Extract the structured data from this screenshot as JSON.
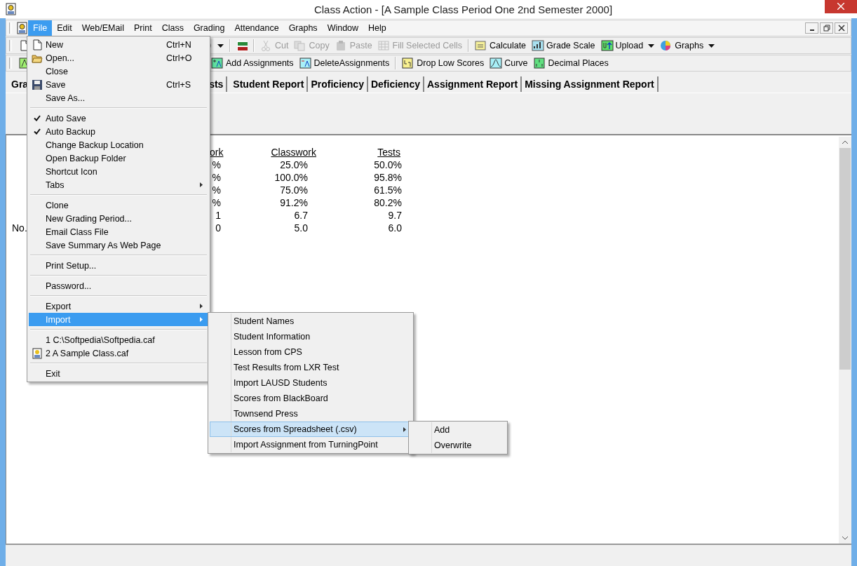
{
  "window": {
    "title": "Class Action - [A Sample Class Period One 2nd Semester 2000]"
  },
  "menubar": [
    {
      "label": "File",
      "selected": true
    },
    {
      "label": "Edit",
      "selected": false
    },
    {
      "label": "Web/EMail",
      "selected": false
    },
    {
      "label": "Print",
      "selected": false
    },
    {
      "label": "Class",
      "selected": false
    },
    {
      "label": "Grading",
      "selected": false
    },
    {
      "label": "Attendance",
      "selected": false
    },
    {
      "label": "Graphs",
      "selected": false
    },
    {
      "label": "Window",
      "selected": false
    },
    {
      "label": "Help",
      "selected": false
    }
  ],
  "toolbar_1": [
    {
      "kind": "icon"
    },
    {
      "kind": "gap"
    },
    {
      "kind": "dropdown-icon"
    },
    {
      "kind": "sep"
    },
    {
      "kind": "icon"
    },
    {
      "kind": "sep"
    },
    {
      "kind": "button",
      "label": "Cut",
      "disabled": true
    },
    {
      "kind": "button",
      "label": "Copy",
      "disabled": true
    },
    {
      "kind": "button",
      "label": "Paste",
      "disabled": true
    },
    {
      "kind": "button",
      "label": "Fill Selected Cells",
      "disabled": true
    },
    {
      "kind": "sep"
    },
    {
      "kind": "button",
      "label": "Calculate",
      "disabled": false
    },
    {
      "kind": "button",
      "label": "Grade Scale",
      "disabled": false
    },
    {
      "kind": "dropdown",
      "label": "Upload",
      "disabled": false
    },
    {
      "kind": "dropdown",
      "label": "Graphs",
      "disabled": false
    }
  ],
  "toolbar_2": [
    {
      "kind": "icon"
    },
    {
      "kind": "gap"
    },
    {
      "kind": "button",
      "label": "Add Assignments",
      "disabled": false
    },
    {
      "kind": "button",
      "label": "DeleteAssignments",
      "disabled": false
    },
    {
      "kind": "sep"
    },
    {
      "kind": "button",
      "label": "Drop Low Scores",
      "disabled": false
    },
    {
      "kind": "button",
      "label": "Curve",
      "disabled": false
    },
    {
      "kind": "button",
      "label": "Decimal Places",
      "disabled": false
    }
  ],
  "tabs": [
    {
      "label": "Gra",
      "selected": false
    },
    {
      "label": "sts",
      "selected": false
    },
    {
      "label": "Student Report",
      "selected": false
    },
    {
      "label": "Proficiency",
      "selected": false
    },
    {
      "label": "Deficiency",
      "selected": false
    },
    {
      "label": "Assignment Report",
      "selected": false
    },
    {
      "label": "Missing Assignment Report",
      "selected": false
    }
  ],
  "summary": {
    "columns": [
      "ork",
      "Classwork",
      "Tests"
    ],
    "rows": [
      {
        "label": "",
        "cells": [
          "%",
          "25.0%",
          "50.0%"
        ]
      },
      {
        "label": "",
        "cells": [
          "%",
          "100.0%",
          "95.8%"
        ]
      },
      {
        "label": "",
        "cells": [
          "%",
          "75.0%",
          "61.5%"
        ]
      },
      {
        "label": "",
        "cells": [
          "%",
          "91.2%",
          "80.2%"
        ]
      },
      {
        "label": "",
        "cells": [
          "1",
          "6.7",
          "9.7"
        ]
      },
      {
        "label": "No.",
        "cells": [
          "0",
          "5.0",
          "6.0"
        ]
      }
    ]
  },
  "file_menu": [
    {
      "kind": "item",
      "label": "New",
      "shortcut": "Ctrl+N"
    },
    {
      "kind": "item",
      "label": "Open...",
      "shortcut": "Ctrl+O"
    },
    {
      "kind": "item",
      "label": "Close"
    },
    {
      "kind": "item",
      "label": "Save",
      "shortcut": "Ctrl+S"
    },
    {
      "kind": "item",
      "label": "Save As..."
    },
    {
      "kind": "separator"
    },
    {
      "kind": "item",
      "label": "Auto Save",
      "checked": true
    },
    {
      "kind": "item",
      "label": "Auto Backup",
      "checked": true
    },
    {
      "kind": "item",
      "label": "Change Backup Location",
      "checked": false
    },
    {
      "kind": "item",
      "label": "Open Backup Folder"
    },
    {
      "kind": "item",
      "label": "Shortcut Icon"
    },
    {
      "kind": "item",
      "label": "Tabs",
      "has_submenu": true
    },
    {
      "kind": "separator"
    },
    {
      "kind": "item",
      "label": "Clone"
    },
    {
      "kind": "item",
      "label": "New Grading Period..."
    },
    {
      "kind": "item",
      "label": "Email Class File"
    },
    {
      "kind": "item",
      "label": "Save Summary As Web Page"
    },
    {
      "kind": "separator"
    },
    {
      "kind": "item",
      "label": "Print Setup..."
    },
    {
      "kind": "separator"
    },
    {
      "kind": "item",
      "label": "Password..."
    },
    {
      "kind": "separator"
    },
    {
      "kind": "item",
      "label": "Export",
      "has_submenu": true
    },
    {
      "kind": "item",
      "label": "Import",
      "has_submenu": true,
      "selected": true,
      "submenu": [
        {
          "kind": "item",
          "label": "Student Names"
        },
        {
          "kind": "item",
          "label": "Student Information"
        },
        {
          "kind": "item",
          "label": "Lesson from CPS"
        },
        {
          "kind": "item",
          "label": "Test Results from LXR Test"
        },
        {
          "kind": "item",
          "label": "Import LAUSD Students"
        },
        {
          "kind": "item",
          "label": "Scores from BlackBoard"
        },
        {
          "kind": "item",
          "label": "Townsend Press"
        },
        {
          "kind": "item",
          "label": "Scores from Spreadsheet (.csv)",
          "has_submenu": true,
          "selected": true,
          "submenu": [
            {
              "kind": "item",
              "label": "Add"
            },
            {
              "kind": "item",
              "label": "Overwrite"
            }
          ]
        },
        {
          "kind": "item",
          "label": "Import Assignment from TurningPoint"
        }
      ]
    },
    {
      "kind": "separator"
    },
    {
      "kind": "item",
      "label": "1 C:\\Softpedia\\Softpedia.caf"
    },
    {
      "kind": "item",
      "label": "2 A Sample Class.caf"
    },
    {
      "kind": "separator"
    },
    {
      "kind": "item",
      "label": "Exit"
    }
  ]
}
